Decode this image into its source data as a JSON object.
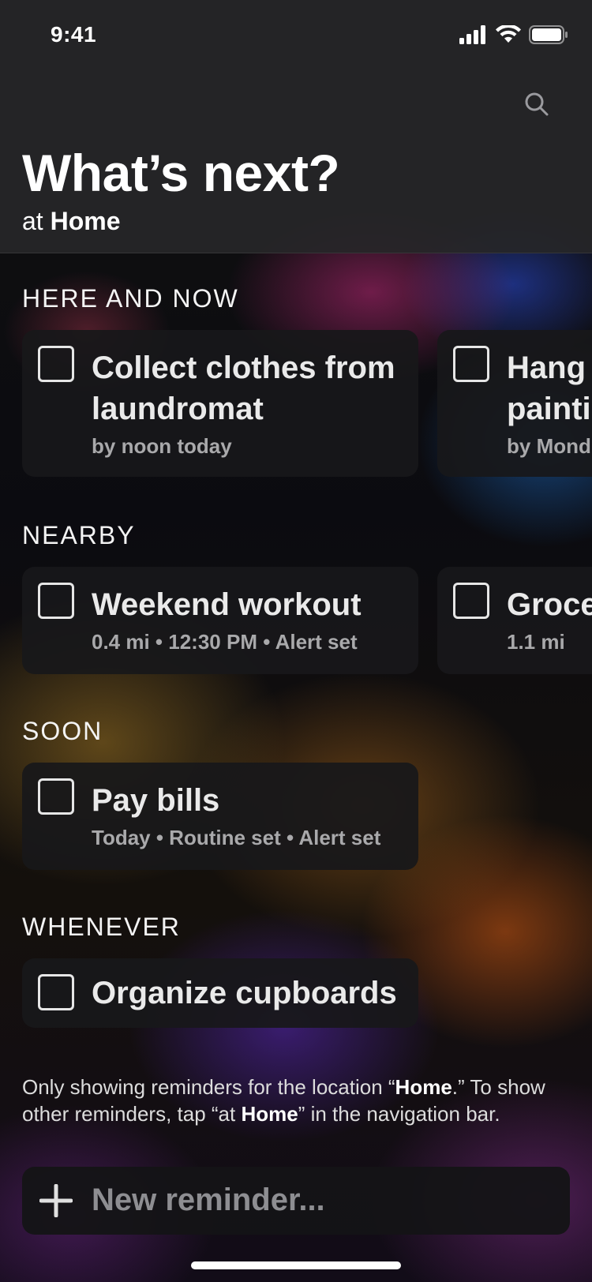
{
  "status_bar": {
    "time": "9:41"
  },
  "header": {
    "title": "What’s next?",
    "subtitle_prefix": "at ",
    "subtitle_location": "Home"
  },
  "sections": {
    "here_and_now": {
      "label": "HERE AND NOW",
      "items": [
        {
          "title_line1": "Collect clothes from",
          "title_line2": "laundromat",
          "detail": "by noon today"
        },
        {
          "title_line1": "Hang",
          "title_line2": "painti",
          "detail": "by Mond"
        }
      ]
    },
    "nearby": {
      "label": "NEARBY",
      "items": [
        {
          "title": "Weekend workout",
          "detail": "0.4 mi • 12:30 PM • Alert set"
        },
        {
          "title": "Groce",
          "detail": "1.1 mi"
        }
      ]
    },
    "soon": {
      "label": "SOON",
      "items": [
        {
          "title": "Pay bills",
          "detail": "Today • Routine set • Alert set"
        }
      ]
    },
    "whenever": {
      "label": "WHENEVER",
      "items": [
        {
          "title": "Organize cupboards"
        }
      ]
    }
  },
  "footer_note": {
    "part1": "Only showing reminders for the location “",
    "location1": "Home",
    "part2": ".” To show other reminders, tap “at ",
    "location2": "Home",
    "part3": "” in the navigation bar."
  },
  "new_reminder": {
    "placeholder": "New reminder..."
  },
  "colors": {
    "header_bg": "#262628",
    "card_bg": "#18181a",
    "secondary_text": "#a9a9ab",
    "placeholder_text": "#8e8e92"
  }
}
